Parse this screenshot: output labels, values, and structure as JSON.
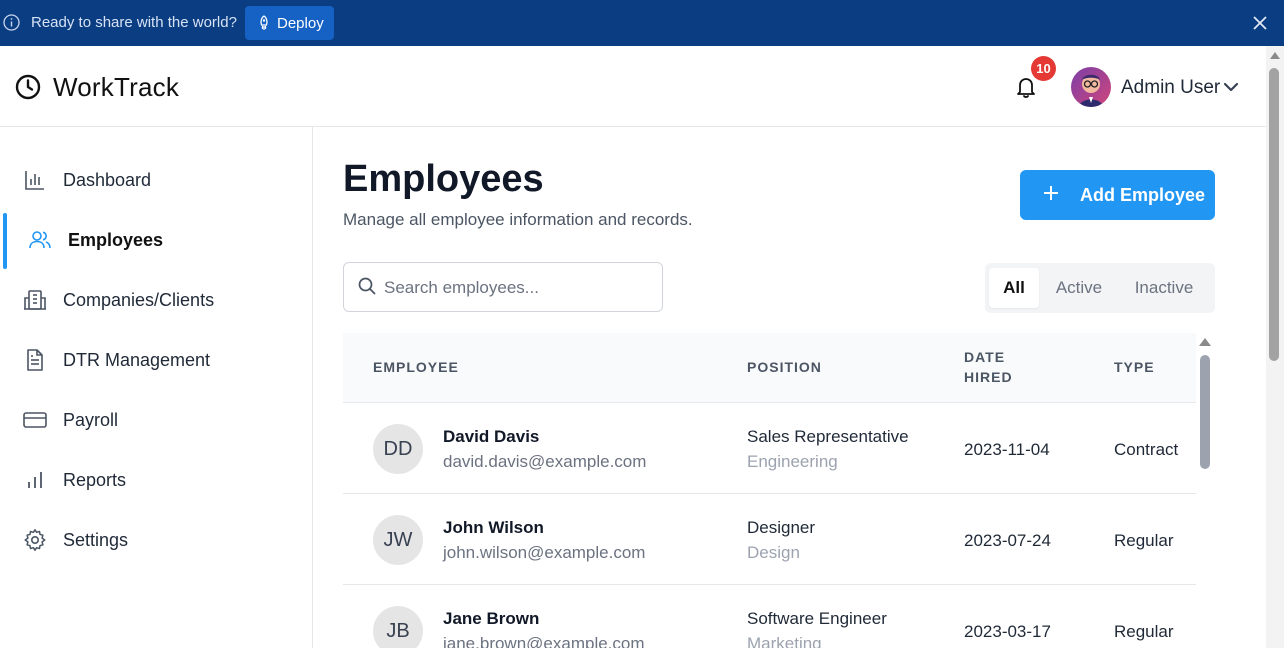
{
  "banner": {
    "message": "Ready to share with the world?",
    "deploy_label": "Deploy"
  },
  "app": {
    "name": "WorkTrack"
  },
  "header": {
    "notification_count": "10",
    "user_name": "Admin User"
  },
  "sidebar": {
    "items": [
      {
        "label": "Dashboard",
        "icon": "bar-chart-icon",
        "active": false
      },
      {
        "label": "Employees",
        "icon": "users-icon",
        "active": true
      },
      {
        "label": "Companies/Clients",
        "icon": "building-icon",
        "active": false
      },
      {
        "label": "DTR Management",
        "icon": "document-icon",
        "active": false
      },
      {
        "label": "Payroll",
        "icon": "credit-card-icon",
        "active": false
      },
      {
        "label": "Reports",
        "icon": "reports-icon",
        "active": false
      },
      {
        "label": "Settings",
        "icon": "gear-icon",
        "active": false
      }
    ]
  },
  "main": {
    "title": "Employees",
    "subtitle": "Manage all employee information and records.",
    "add_button_label": "Add Employee",
    "search_placeholder": "Search employees...",
    "filters": [
      "All",
      "Active",
      "Inactive"
    ],
    "selected_filter": "All"
  },
  "table": {
    "headers": {
      "employee": "EMPLOYEE",
      "position": "POSITION",
      "date_hired_line1": "DATE",
      "date_hired_line2": "HIRED",
      "type": "TYPE"
    },
    "rows": [
      {
        "initials": "DD",
        "name": "David Davis",
        "email": "david.davis@example.com",
        "position": "Sales Representative",
        "department": "Engineering",
        "date_hired": "2023-11-04",
        "type": "Contract"
      },
      {
        "initials": "JW",
        "name": "John Wilson",
        "email": "john.wilson@example.com",
        "position": "Designer",
        "department": "Design",
        "date_hired": "2023-07-24",
        "type": "Regular"
      },
      {
        "initials": "JB",
        "name": "Jane Brown",
        "email": "jane.brown@example.com",
        "position": "Software Engineer",
        "department": "Marketing",
        "date_hired": "2023-03-17",
        "type": "Regular"
      }
    ]
  },
  "colors": {
    "banner_bg": "#0b3d82",
    "deploy_bg": "#1662c4",
    "accent": "#2196f3",
    "badge": "#e53935"
  }
}
